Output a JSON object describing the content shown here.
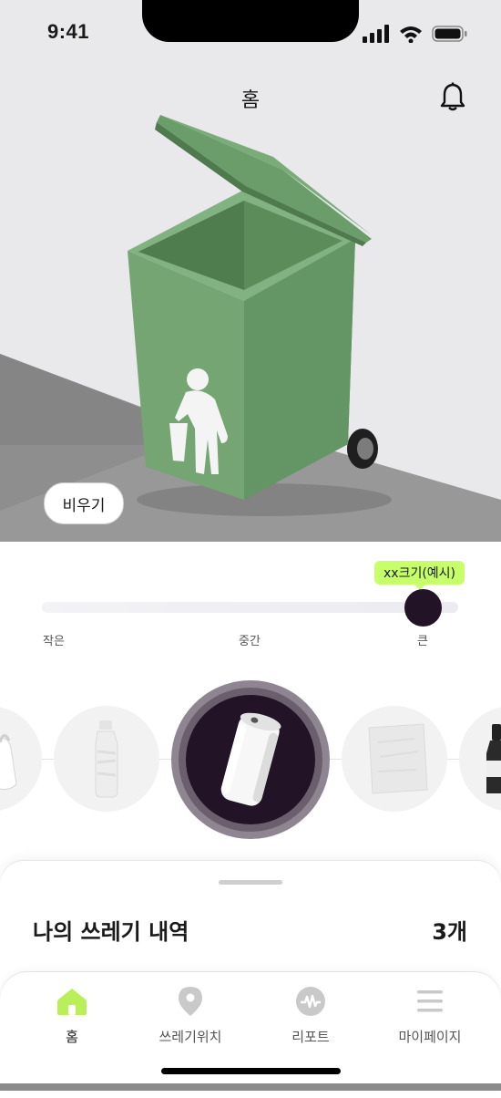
{
  "status_bar": {
    "time": "9:41"
  },
  "header": {
    "title": "홈"
  },
  "hero": {
    "empty_button": "비우기"
  },
  "size_slider": {
    "tooltip": "xx크기(예시)",
    "labels": [
      "작은",
      "중간",
      "큰"
    ],
    "value_fraction": 0.92
  },
  "trash_types": {
    "items": [
      "plastic-bag-icon",
      "plastic-bottle-icon",
      "can-icon",
      "paper-icon",
      "glass-bottle-icon"
    ],
    "selected": "can-icon"
  },
  "history": {
    "title": "나의 쓰레기 내역",
    "count": "3개"
  },
  "tabbar": {
    "tabs": [
      {
        "label": "홈",
        "icon": "home-icon",
        "active": true
      },
      {
        "label": "쓰레기위치",
        "icon": "location-pin-icon",
        "active": false
      },
      {
        "label": "리포트",
        "icon": "report-icon",
        "active": false
      },
      {
        "label": "마이페이지",
        "icon": "menu-icon",
        "active": false
      }
    ]
  },
  "colors": {
    "accent": "#c7ff6a",
    "dark": "#221326",
    "bin_green": "#6fa16e",
    "active_tab_icon": "#b9f05a"
  }
}
